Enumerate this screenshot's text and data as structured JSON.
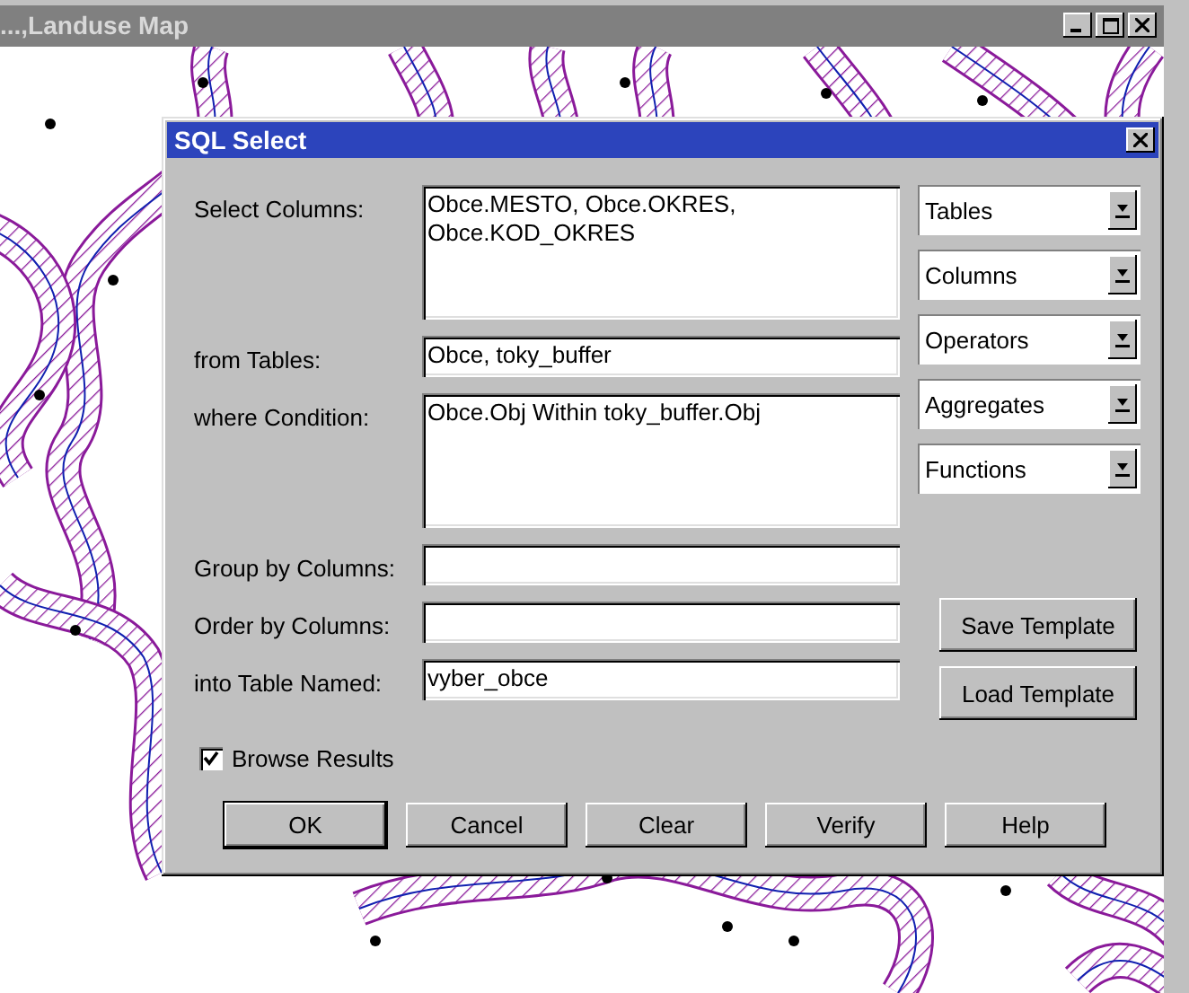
{
  "map_window": {
    "title": "...,Landuse Map"
  },
  "dialog": {
    "title": "SQL Select",
    "fields": [
      {
        "label": "Select Columns:",
        "kind": "area",
        "value": "Obce.MESTO, Obce.OKRES, Obce.KOD_OKRES"
      },
      {
        "label": "from Tables:",
        "kind": "line",
        "value": "Obce, toky_buffer"
      },
      {
        "label": "where Condition:",
        "kind": "area",
        "value": "Obce.Obj Within toky_buffer.Obj"
      },
      {
        "label": "Group by Columns:",
        "kind": "line"
      },
      {
        "label": "Order by Columns:",
        "kind": "line"
      },
      {
        "label": "into Table Named:",
        "kind": "line",
        "value": "vyber_obce"
      }
    ],
    "pickers": [
      "Tables",
      "Columns",
      "Operators",
      "Aggregates",
      "Functions"
    ],
    "template_buttons": [
      "Save Template",
      "Load Template"
    ],
    "browse_results": {
      "label": "Browse Results",
      "checked": true
    },
    "buttons": [
      {
        "label": "OK",
        "default": true
      },
      {
        "label": "Cancel",
        "default": false
      },
      {
        "label": "Clear",
        "default": false
      },
      {
        "label": "Verify",
        "default": false
      },
      {
        "label": "Help",
        "default": false
      }
    ]
  }
}
